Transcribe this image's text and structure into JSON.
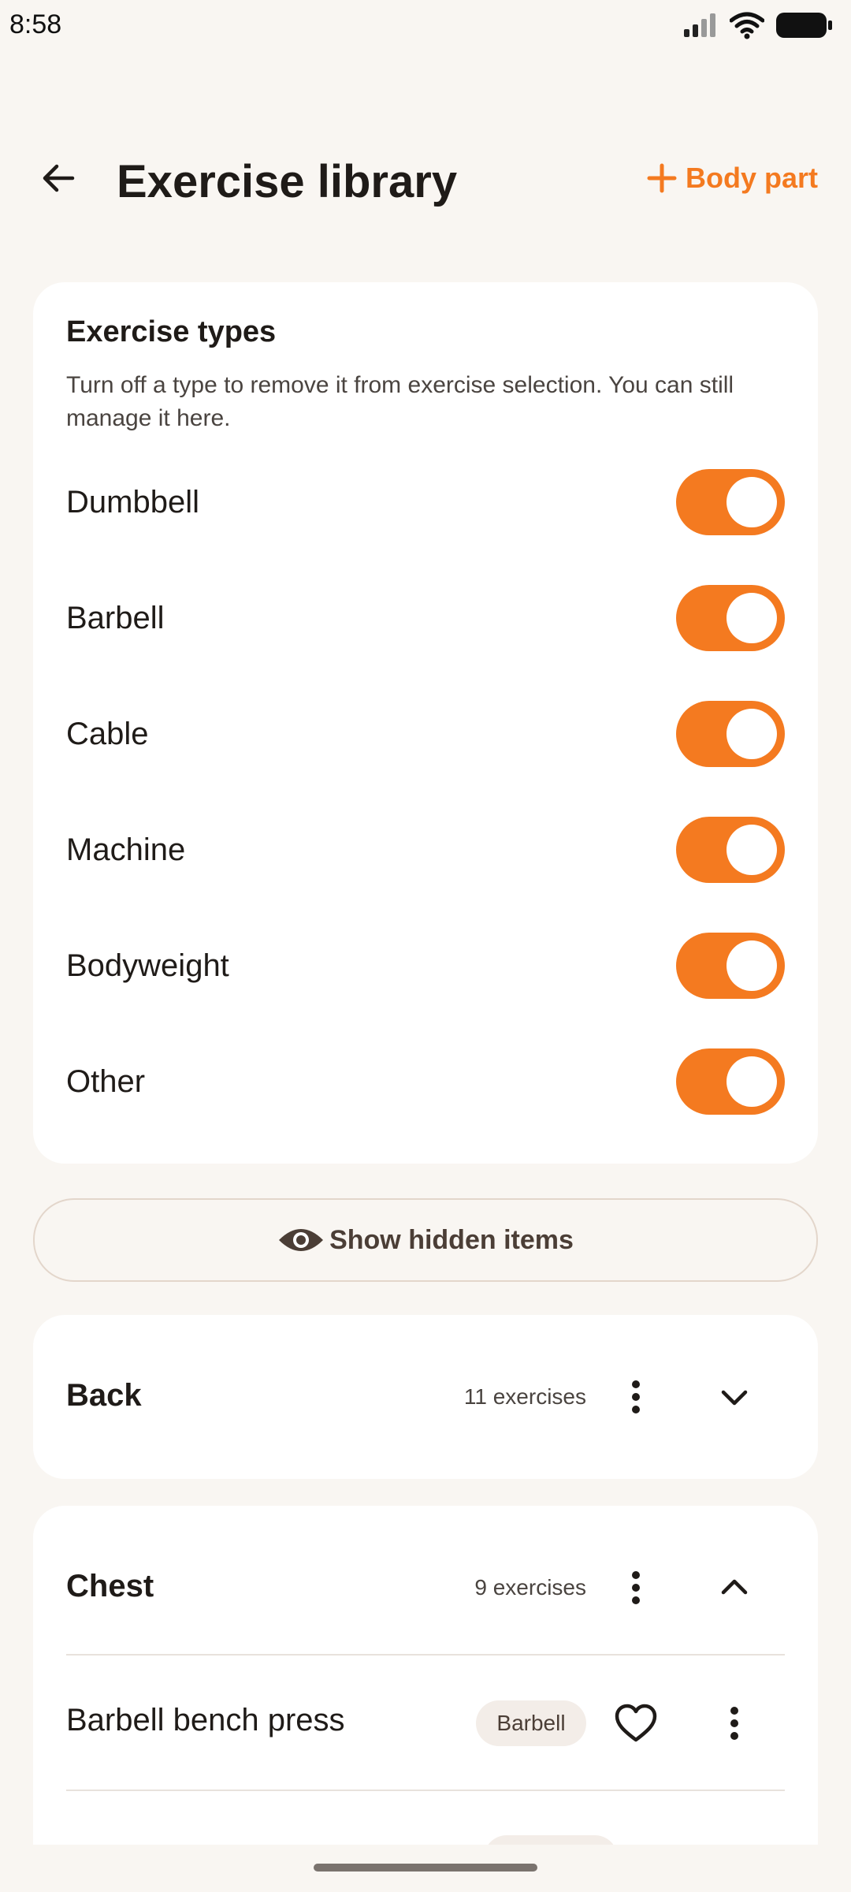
{
  "status": {
    "time": "8:58"
  },
  "header": {
    "title": "Exercise library",
    "add_label": "Body part"
  },
  "types": {
    "title": "Exercise types",
    "description": "Turn off a type to remove it from exercise selection. You can still manage it here.",
    "items": [
      {
        "label": "Dumbbell",
        "enabled": true
      },
      {
        "label": "Barbell",
        "enabled": true
      },
      {
        "label": "Cable",
        "enabled": true
      },
      {
        "label": "Machine",
        "enabled": true
      },
      {
        "label": "Bodyweight",
        "enabled": true
      },
      {
        "label": "Other",
        "enabled": true
      }
    ]
  },
  "hidden_button": {
    "label": "Show hidden items"
  },
  "groups": [
    {
      "name": "Back",
      "count": "11 exercises",
      "expanded": false
    },
    {
      "name": "Chest",
      "count": "9 exercises",
      "expanded": true,
      "exercises": [
        {
          "name": "Barbell bench press",
          "type": "Barbell"
        }
      ]
    }
  ],
  "colors": {
    "accent": "#f47a20",
    "background": "#f9f6f2",
    "card": "#ffffff"
  }
}
